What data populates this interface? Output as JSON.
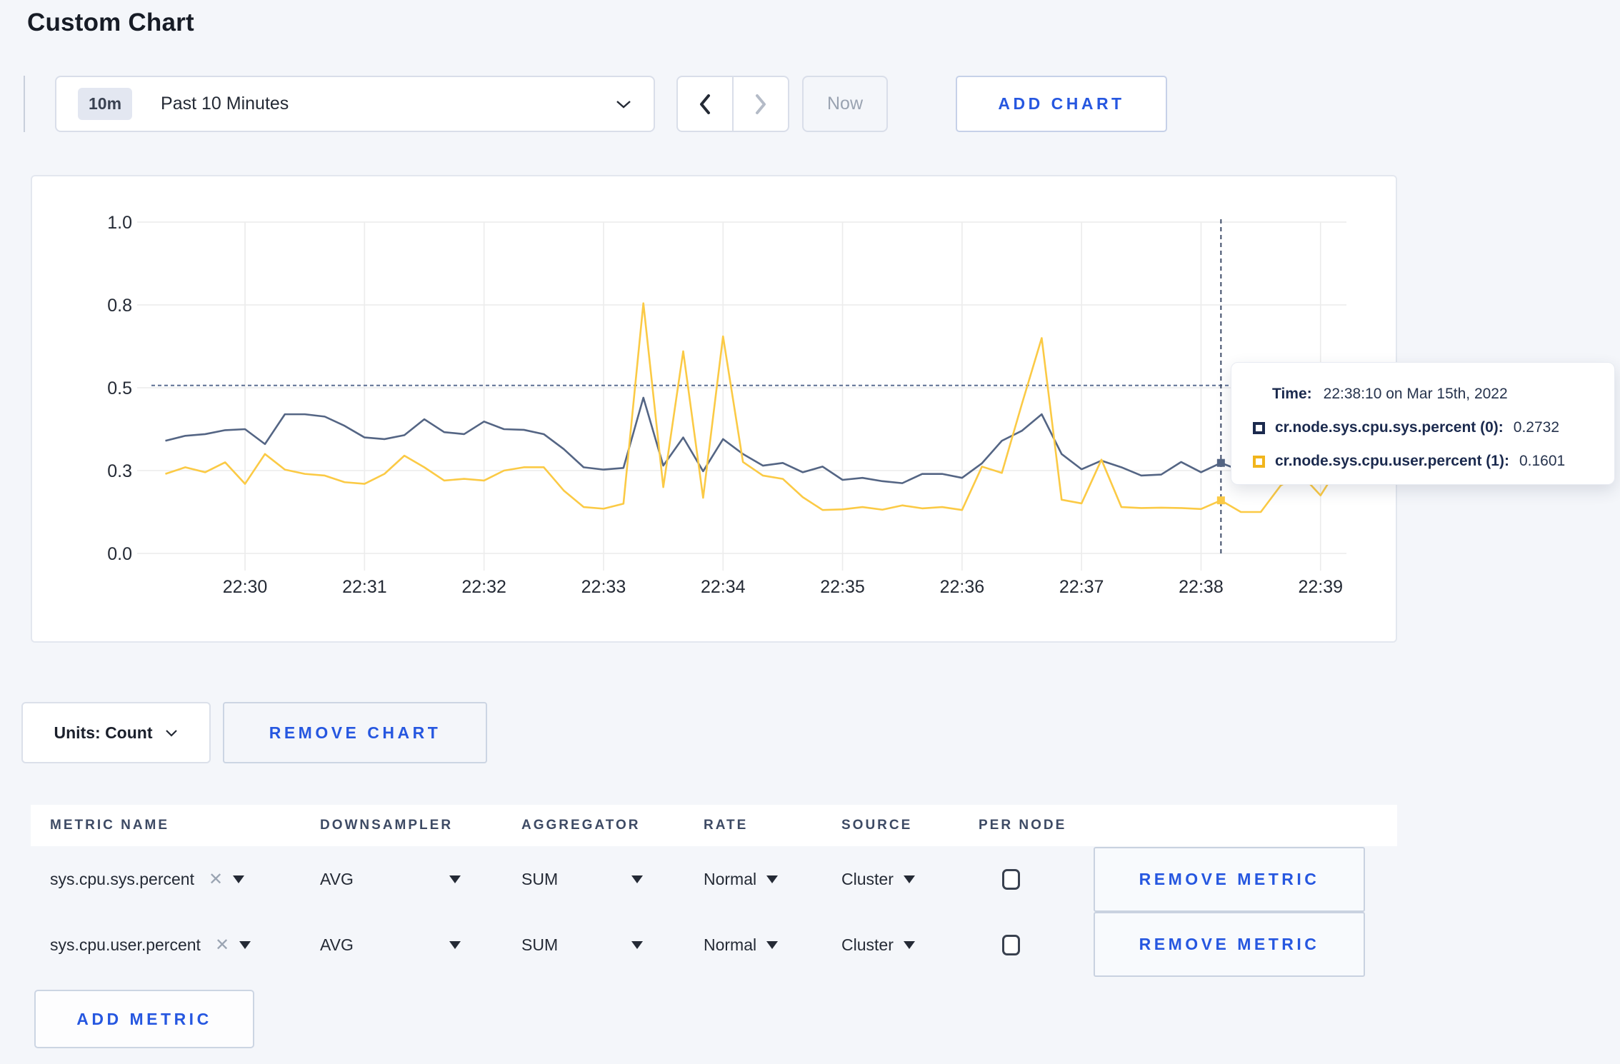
{
  "page": {
    "title": "Custom Chart"
  },
  "toolbar": {
    "time_range": {
      "badge": "10m",
      "label": "Past 10 Minutes"
    },
    "now_label": "Now",
    "add_chart_label": "ADD CHART"
  },
  "tooltip": {
    "time_label": "Time:",
    "time_value": "22:38:10 on Mar 15th, 2022",
    "rows": [
      {
        "label": "cr.node.sys.cpu.sys.percent (0):",
        "value": "0.2732",
        "color": "#1b2a4e"
      },
      {
        "label": "cr.node.sys.cpu.user.percent (1):",
        "value": "0.1601",
        "color": "#f1b51c"
      }
    ]
  },
  "chart_data": {
    "type": "line",
    "title": "",
    "xlabel": "",
    "ylabel": "",
    "ylim": [
      0,
      1
    ],
    "grid": true,
    "legend_position": "tooltip",
    "x_domain": [
      "22:29:13",
      "22:39:13"
    ],
    "x_ticks": [
      "22:30",
      "22:31",
      "22:32",
      "22:33",
      "22:34",
      "22:35",
      "22:36",
      "22:37",
      "22:38",
      "22:39"
    ],
    "y_ticks": {
      "values": [
        0,
        0.25,
        0.5,
        0.75,
        1.0
      ],
      "labels": [
        "0.0",
        "0.3",
        "0.5",
        "0.8",
        "1.0"
      ]
    },
    "crosshair": {
      "time": "22:38:10",
      "h_value": 0.507
    },
    "x": [
      "22:29:20",
      "22:29:30",
      "22:29:40",
      "22:29:50",
      "22:30:00",
      "22:30:10",
      "22:30:20",
      "22:30:30",
      "22:30:40",
      "22:30:50",
      "22:31:00",
      "22:31:10",
      "22:31:20",
      "22:31:30",
      "22:31:40",
      "22:31:50",
      "22:32:00",
      "22:32:10",
      "22:32:20",
      "22:32:30",
      "22:32:40",
      "22:32:50",
      "22:33:00",
      "22:33:10",
      "22:33:20",
      "22:33:30",
      "22:33:40",
      "22:33:50",
      "22:34:00",
      "22:34:10",
      "22:34:20",
      "22:34:30",
      "22:34:40",
      "22:34:50",
      "22:35:00",
      "22:35:10",
      "22:35:20",
      "22:35:30",
      "22:35:40",
      "22:35:50",
      "22:36:00",
      "22:36:10",
      "22:36:20",
      "22:36:30",
      "22:36:40",
      "22:36:50",
      "22:37:00",
      "22:37:10",
      "22:37:20",
      "22:37:30",
      "22:37:40",
      "22:37:50",
      "22:38:00",
      "22:38:10",
      "22:38:20",
      "22:38:30",
      "22:38:40",
      "22:38:50",
      "22:39:00",
      "22:39:10"
    ],
    "series": [
      {
        "name": "cr.node.sys.cpu.sys.percent",
        "color": "#546584",
        "values": [
          0.34,
          0.355,
          0.36,
          0.372,
          0.375,
          0.33,
          0.42,
          0.42,
          0.413,
          0.385,
          0.35,
          0.345,
          0.357,
          0.405,
          0.366,
          0.36,
          0.398,
          0.375,
          0.373,
          0.36,
          0.315,
          0.26,
          0.253,
          0.258,
          0.47,
          0.265,
          0.35,
          0.248,
          0.345,
          0.3,
          0.265,
          0.273,
          0.245,
          0.262,
          0.222,
          0.228,
          0.218,
          0.212,
          0.24,
          0.24,
          0.228,
          0.272,
          0.34,
          0.37,
          0.42,
          0.3,
          0.254,
          0.28,
          0.26,
          0.235,
          0.238,
          0.276,
          0.245,
          0.2732,
          0.25,
          0.265,
          0.29,
          0.3,
          0.295,
          0.305
        ]
      },
      {
        "name": "cr.node.sys.cpu.user.percent",
        "color": "#fbca45",
        "values": [
          0.24,
          0.26,
          0.245,
          0.275,
          0.21,
          0.3,
          0.253,
          0.24,
          0.235,
          0.215,
          0.21,
          0.24,
          0.295,
          0.26,
          0.22,
          0.225,
          0.22,
          0.25,
          0.26,
          0.26,
          0.19,
          0.14,
          0.135,
          0.15,
          0.755,
          0.2,
          0.61,
          0.168,
          0.655,
          0.276,
          0.235,
          0.225,
          0.17,
          0.131,
          0.133,
          0.14,
          0.132,
          0.145,
          0.136,
          0.14,
          0.131,
          0.262,
          0.243,
          0.45,
          0.65,
          0.162,
          0.151,
          0.283,
          0.14,
          0.137,
          0.138,
          0.137,
          0.134,
          0.1601,
          0.125,
          0.125,
          0.205,
          0.24,
          0.175,
          0.27
        ]
      }
    ]
  },
  "units_row": {
    "units_label": "Units: Count",
    "remove_chart_label": "REMOVE CHART"
  },
  "metrics_table": {
    "headers": [
      "METRIC NAME",
      "DOWNSAMPLER",
      "AGGREGATOR",
      "RATE",
      "SOURCE",
      "PER NODE"
    ],
    "rows": [
      {
        "metric": "sys.cpu.sys.percent",
        "downsampler": "AVG",
        "aggregator": "SUM",
        "rate": "Normal",
        "source": "Cluster",
        "per_node": false,
        "remove_label": "REMOVE METRIC"
      },
      {
        "metric": "sys.cpu.user.percent",
        "downsampler": "AVG",
        "aggregator": "SUM",
        "rate": "Normal",
        "source": "Cluster",
        "per_node": false,
        "remove_label": "REMOVE METRIC"
      }
    ],
    "add_metric_label": "ADD METRIC"
  }
}
